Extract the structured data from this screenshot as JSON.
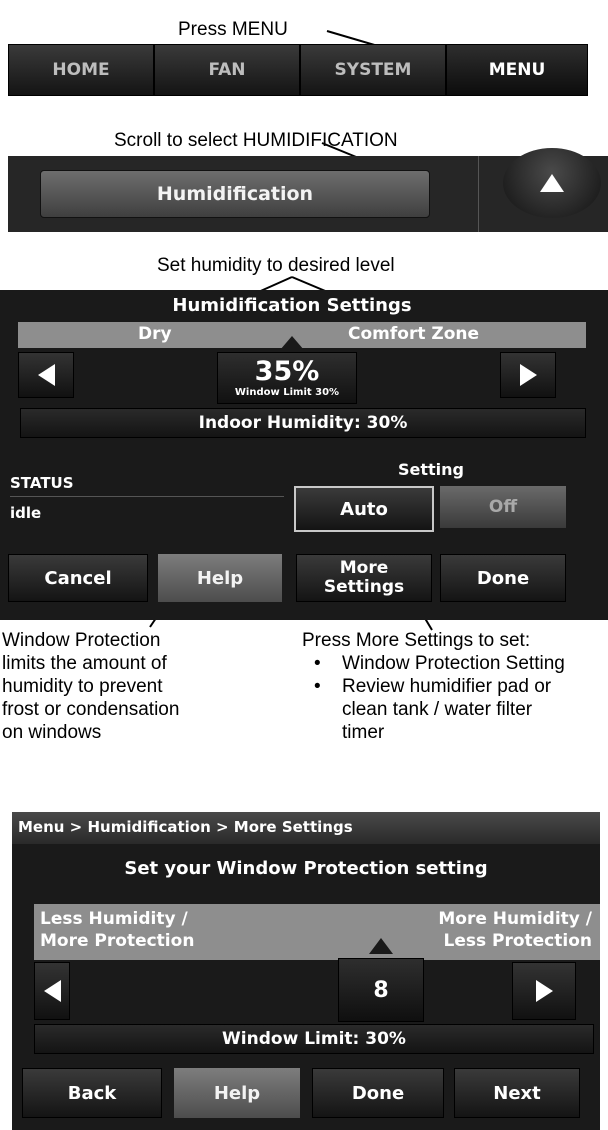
{
  "callouts": {
    "press_menu": "Press MENU",
    "scroll_select": "Scroll to select HUMIDIFICATION",
    "set_humidity": "Set humidity to desired level",
    "window_protection_lines": [
      "Window Protection",
      "limits the amount of",
      "humidity to prevent",
      "frost or condensation",
      "on windows"
    ],
    "more_settings_title": "Press More Settings to set:",
    "more_settings_bullets": [
      "Window Protection Setting",
      "Review humidifier pad or clean tank / water filter timer"
    ]
  },
  "menu_bar": {
    "tabs": [
      "HOME",
      "FAN",
      "SYSTEM",
      "MENU"
    ]
  },
  "scroll_panel": {
    "item": "Humidification"
  },
  "humid_screen": {
    "title": "Humidification Settings",
    "left_label": "Dry",
    "right_label": "Comfort Zone",
    "value": "35%",
    "window_limit": "Window Limit 30%",
    "indoor": "Indoor Humidity: 30%",
    "status_label": "STATUS",
    "status_value": "idle",
    "setting_label": "Setting",
    "auto": "Auto",
    "off": "Off",
    "cancel": "Cancel",
    "help": "Help",
    "more_line1": "More",
    "more_line2": "Settings",
    "done": "Done"
  },
  "wp_screen": {
    "breadcrumb": "Menu > Humidification > More Settings",
    "title": "Set your Window Protection setting",
    "left_line1": "Less Humidity /",
    "left_line2": "More Protection",
    "right_line1": "More Humidity /",
    "right_line2": "Less Protection",
    "value": "8",
    "window_limit": "Window Limit: 30%",
    "back": "Back",
    "help": "Help",
    "done": "Done",
    "next": "Next"
  }
}
